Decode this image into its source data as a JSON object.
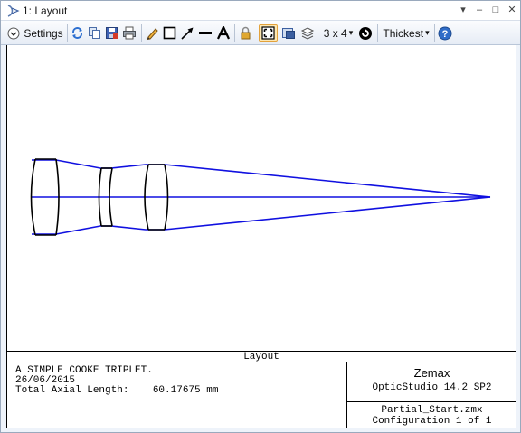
{
  "window": {
    "title": "1: Layout",
    "buttons": [
      "▾",
      "–",
      "□",
      "✕"
    ]
  },
  "toolbar": {
    "settings_label": "Settings",
    "config_label": "3 x 4",
    "thickness_label": "Thickest",
    "dropdown_arrow": "▾",
    "icons": [
      "refresh-icon",
      "copy-icon",
      "save-icon",
      "print-icon",
      "pencil-icon",
      "rectangle-icon",
      "arrow-icon",
      "line-icon",
      "text-icon",
      "lock-icon",
      "fit-icon",
      "export-icon",
      "layers-icon",
      "rotate-icon",
      "help-icon"
    ]
  },
  "plot": {
    "lens_color": "#000000",
    "ray_color": "#1010e0"
  },
  "footer": {
    "title": "Layout",
    "description_lines": [
      "A SIMPLE COOKE TRIPLET.",
      "26/06/2015",
      "Total Axial Length:    60.17675 mm"
    ],
    "brand": "Zemax",
    "version": "OpticStudio 14.2 SP2",
    "file": "Partial_Start.zmx",
    "configuration": "Configuration 1 of 1"
  }
}
